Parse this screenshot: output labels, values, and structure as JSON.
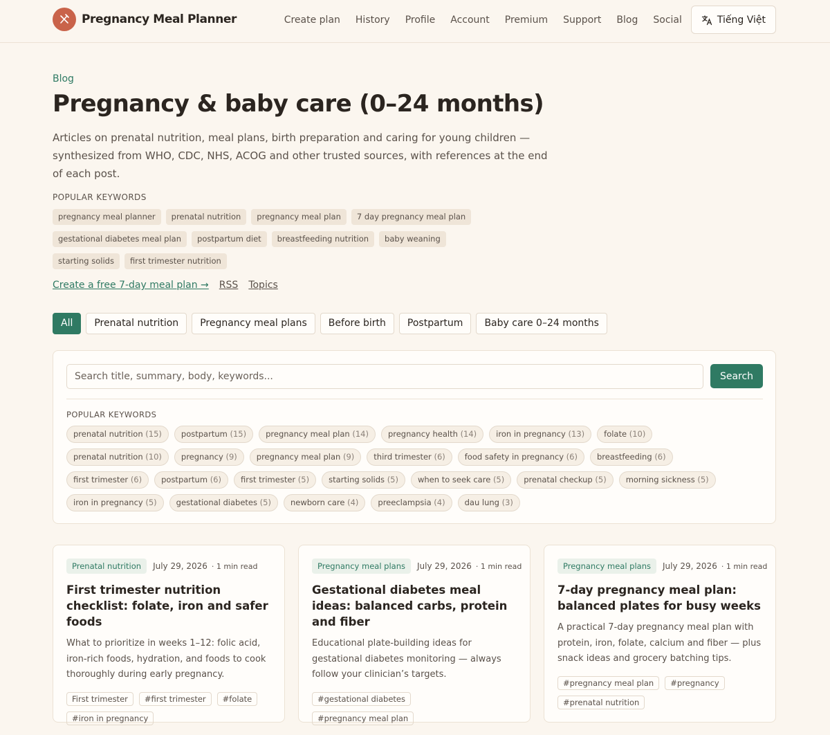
{
  "brand": {
    "name": "Pregnancy Meal Planner",
    "accent": "#c9634a",
    "primary": "#2f7a63"
  },
  "nav": {
    "items": [
      "Create plan",
      "History",
      "Profile",
      "Account",
      "Premium",
      "Support",
      "Blog",
      "Social"
    ],
    "language": "Tiếng Việt"
  },
  "hero": {
    "eyebrow": "Blog",
    "title": "Pregnancy & baby care (0–24 months)",
    "description": "Articles on prenatal nutrition, meal plans, birth preparation and caring for young children — synthesized from WHO, CDC, NHS, ACOG and other trusted sources, with references at the end of each post.",
    "keywords_label": "POPULAR KEYWORDS",
    "keywords": [
      "pregnancy meal planner",
      "prenatal nutrition",
      "pregnancy meal plan",
      "7 day pregnancy meal plan",
      "gestational diabetes meal plan",
      "postpartum diet",
      "breastfeeding nutrition",
      "baby weaning",
      "starting solids",
      "first trimester nutrition"
    ],
    "links": {
      "cta": "Create a free 7-day meal plan →",
      "rss": "RSS",
      "topics": "Topics"
    }
  },
  "filters": [
    "All",
    "Prenatal nutrition",
    "Pregnancy meal plans",
    "Before birth",
    "Postpartum",
    "Baby care 0–24 months"
  ],
  "search": {
    "placeholder": "Search title, summary, body, keywords...",
    "button": "Search",
    "keywords_label": "POPULAR KEYWORDS",
    "pills": [
      {
        "label": "prenatal nutrition",
        "count": "(15)"
      },
      {
        "label": "postpartum",
        "count": "(15)"
      },
      {
        "label": "pregnancy meal plan",
        "count": "(14)"
      },
      {
        "label": "pregnancy health",
        "count": "(14)"
      },
      {
        "label": "iron in pregnancy",
        "count": "(13)"
      },
      {
        "label": "folate",
        "count": "(10)"
      },
      {
        "label": "prenatal nutrition",
        "count": "(10)"
      },
      {
        "label": "pregnancy",
        "count": "(9)"
      },
      {
        "label": "pregnancy meal plan",
        "count": "(9)"
      },
      {
        "label": "third trimester",
        "count": "(6)"
      },
      {
        "label": "food safety in pregnancy",
        "count": "(6)"
      },
      {
        "label": "breastfeeding",
        "count": "(6)"
      },
      {
        "label": "first trimester",
        "count": "(6)"
      },
      {
        "label": "postpartum",
        "count": "(6)"
      },
      {
        "label": "first trimester",
        "count": "(5)"
      },
      {
        "label": "starting solids",
        "count": "(5)"
      },
      {
        "label": "when to seek care",
        "count": "(5)"
      },
      {
        "label": "prenatal checkup",
        "count": "(5)"
      },
      {
        "label": "morning sickness",
        "count": "(5)"
      },
      {
        "label": "iron in pregnancy",
        "count": "(5)"
      },
      {
        "label": "gestational diabetes",
        "count": "(5)"
      },
      {
        "label": "newborn care",
        "count": "(4)"
      },
      {
        "label": "preeclampsia",
        "count": "(4)"
      },
      {
        "label": "dau lung",
        "count": "(3)"
      }
    ]
  },
  "cards": [
    {
      "category": "Prenatal nutrition",
      "date": "July 29, 2026",
      "read": "· 1 min read",
      "title": "First trimester nutrition checklist: folate, iron and safer foods",
      "excerpt": "What to prioritize in weeks 1–12: folic acid, iron-rich foods, hydration, and foods to cook thoroughly during early pregnancy.",
      "tags": [
        "First trimester",
        "#first trimester",
        "#folate",
        "#iron in pregnancy"
      ]
    },
    {
      "category": "Pregnancy meal plans",
      "date": "July 29, 2026",
      "read": "· 1 min read",
      "title": "Gestational diabetes meal ideas: balanced carbs, protein and fiber",
      "excerpt": "Educational plate-building ideas for gestational diabetes monitoring — always follow your clinician’s targets.",
      "tags": [
        "#gestational diabetes",
        "#pregnancy meal plan"
      ]
    },
    {
      "category": "Pregnancy meal plans",
      "date": "July 29, 2026",
      "read": "· 1 min read",
      "title": "7-day pregnancy meal plan: balanced plates for busy weeks",
      "excerpt": "A practical 7-day pregnancy meal plan with protein, iron, folate, calcium and fiber — plus snack ideas and grocery batching tips.",
      "tags": [
        "#pregnancy meal plan",
        "#pregnancy",
        "#prenatal nutrition"
      ]
    }
  ]
}
